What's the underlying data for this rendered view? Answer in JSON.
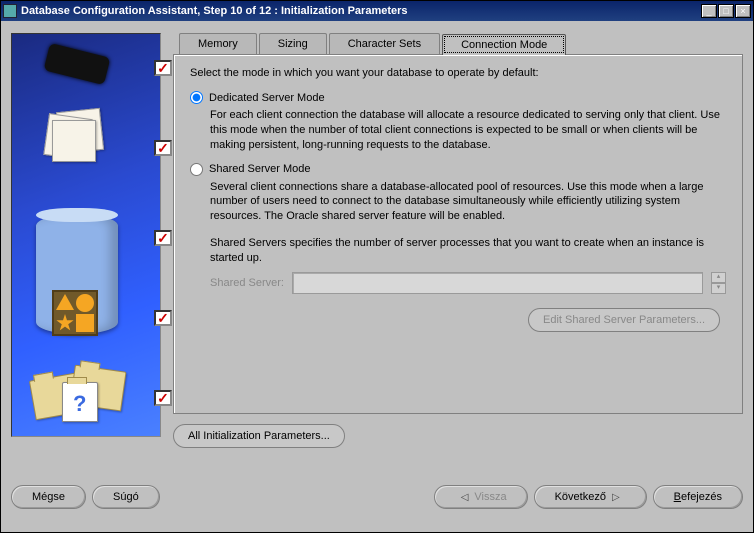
{
  "window": {
    "title": "Database Configuration Assistant, Step 10 of 12 : Initialization Parameters"
  },
  "tabs": {
    "memory": "Memory",
    "sizing": "Sizing",
    "charsets": "Character Sets",
    "connmode": "Connection Mode"
  },
  "panel": {
    "intro": "Select the mode in which you want your database to operate by default:",
    "dedicated": {
      "label": "Dedicated Server Mode",
      "desc": "For each client connection the database will allocate a resource dedicated to serving only that client.  Use this mode when the number of total client connections is expected to be small or when clients will be making persistent, long-running requests to the database."
    },
    "shared": {
      "label": "Shared Server Mode",
      "desc": "Several client connections share a database-allocated pool of resources.  Use this mode when a large number of users need to connect to the database simultaneously while efficiently utilizing system resources.  The Oracle shared server feature will be enabled.",
      "note": "Shared Servers specifies the number of server processes that you want to create when an instance is started up.",
      "field_label": "Shared Server:",
      "field_value": ""
    },
    "edit_sp": "Edit Shared Server Parameters...",
    "all_params": "All Initialization Parameters..."
  },
  "footer": {
    "cancel": "Mégse",
    "help": "Súgó",
    "back": "Vissza",
    "next": "Következő",
    "finish": "Befejezés"
  }
}
